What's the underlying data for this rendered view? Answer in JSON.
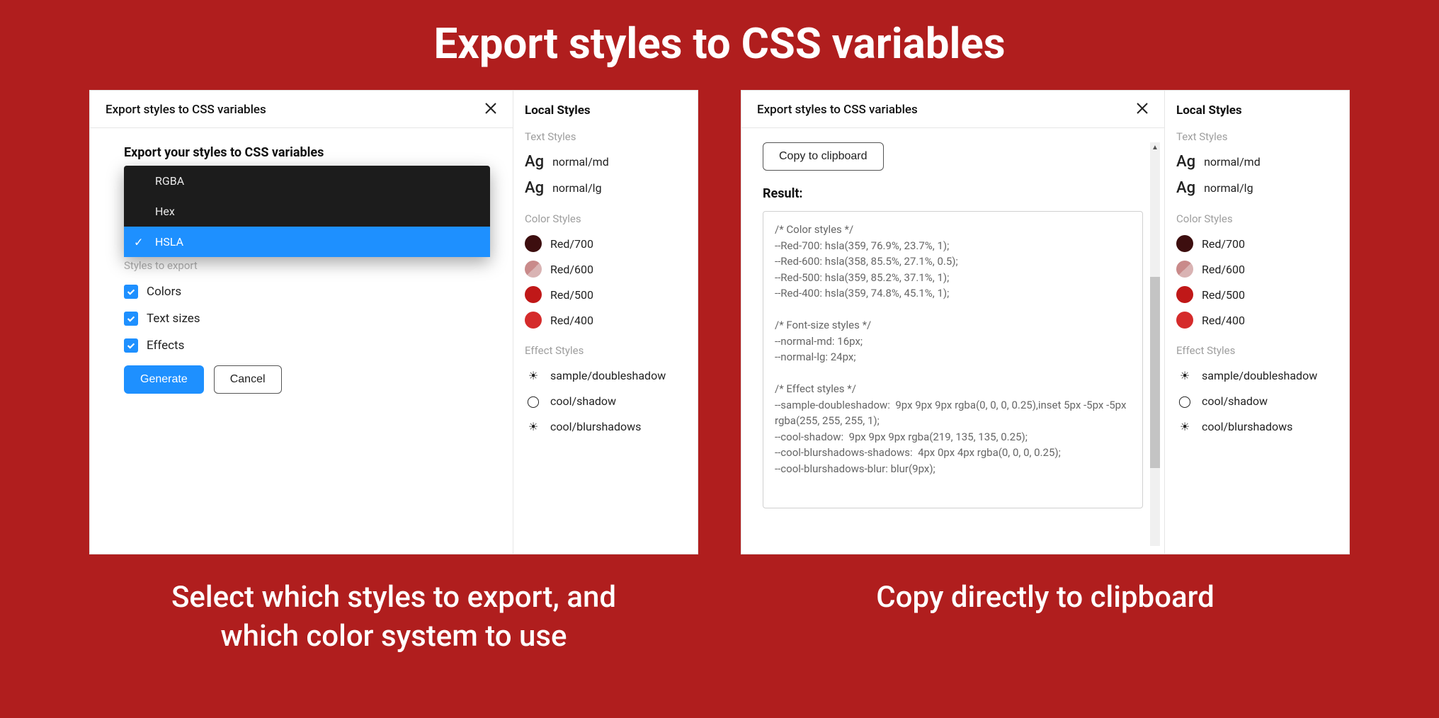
{
  "page": {
    "title": "Export styles to CSS variables"
  },
  "captions": {
    "left": "Select which styles to export, and which color system to use",
    "right": "Copy directly to clipboard"
  },
  "modal": {
    "title": "Export styles to CSS variables",
    "subtitle": "Export your styles to CSS variables",
    "styles_label": "Styles to export",
    "options": {
      "rgba": "RGBA",
      "hex": "Hex",
      "hsla": "HSLA"
    },
    "checks": {
      "colors": "Colors",
      "text_sizes": "Text sizes",
      "effects": "Effects"
    },
    "buttons": {
      "generate": "Generate",
      "cancel": "Cancel",
      "copy": "Copy to clipboard"
    }
  },
  "result": {
    "label": "Result:",
    "code": "/* Color styles */\n--Red-700: hsla(359, 76.9%, 23.7%, 1);\n--Red-600: hsla(358, 85.5%, 27.1%, 0.5);\n--Red-500: hsla(359, 85.2%, 37.1%, 1);\n--Red-400: hsla(359, 74.8%, 45.1%, 1);\n\n/* Font-size styles */\n--normal-md: 16px;\n--normal-lg: 24px;\n\n/* Effect styles */\n--sample-doubleshadow:  9px 9px 9px rgba(0, 0, 0, 0.25),inset 5px -5px -5px rgba(255, 255, 255, 1);\n--cool-shadow:  9px 9px 9px rgba(219, 135, 135, 0.25);\n--cool-blurshadows-shadows:  4px 0px 4px rgba(0, 0, 0, 0.25);\n--cool-blurshadows-blur: blur(9px);"
  },
  "local_styles": {
    "title": "Local Styles",
    "sections": {
      "text": "Text Styles",
      "color": "Color Styles",
      "effect": "Effect Styles"
    },
    "text_items": {
      "md": "normal/md",
      "lg": "normal/lg"
    },
    "color_items": {
      "r700": "Red/700",
      "r600": "Red/600",
      "r500": "Red/500",
      "r400": "Red/400"
    },
    "effect_items": {
      "double": "sample/doubleshadow",
      "cool": "cool/shadow",
      "blur": "cool/blurshadows"
    }
  }
}
